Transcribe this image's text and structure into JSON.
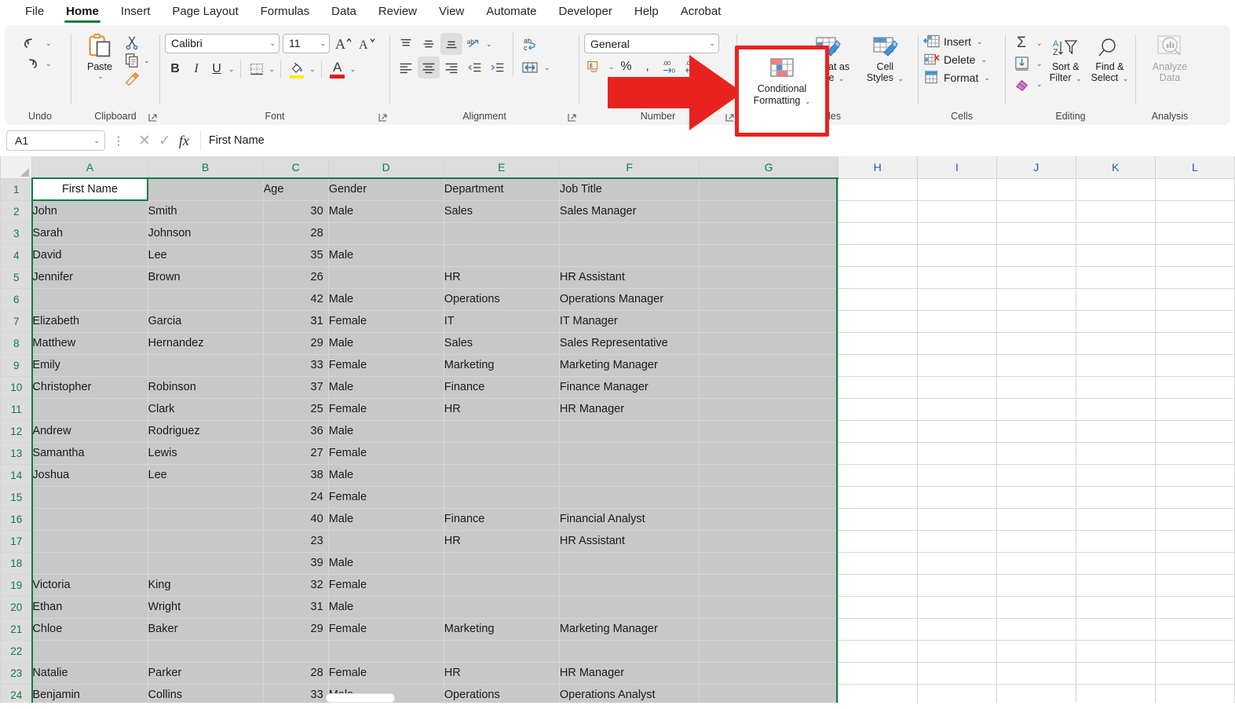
{
  "tabs": [
    {
      "label": "File",
      "active": false
    },
    {
      "label": "Home",
      "active": true
    },
    {
      "label": "Insert",
      "active": false
    },
    {
      "label": "Page Layout",
      "active": false
    },
    {
      "label": "Formulas",
      "active": false
    },
    {
      "label": "Data",
      "active": false
    },
    {
      "label": "Review",
      "active": false
    },
    {
      "label": "View",
      "active": false
    },
    {
      "label": "Automate",
      "active": false
    },
    {
      "label": "Developer",
      "active": false
    },
    {
      "label": "Help",
      "active": false
    },
    {
      "label": "Acrobat",
      "active": false
    }
  ],
  "ribbon": {
    "groups": {
      "undo": {
        "label": "Undo",
        "undo_icon": "undo-arrow-icon",
        "redo_icon": "redo-arrow-icon"
      },
      "clipboard": {
        "label": "Clipboard",
        "paste_label": "Paste",
        "cut_icon": "scissors-icon",
        "copy_icon": "copy-icon",
        "format_painter_icon": "format-painter-icon"
      },
      "font": {
        "label": "Font",
        "font_name": "Calibri",
        "font_size": "11",
        "grow_icon": "grow-font-icon",
        "shrink_icon": "shrink-font-icon",
        "bold": "B",
        "italic": "I",
        "underline": "U",
        "borders_icon": "borders-icon",
        "fill_color_icon": "fill-color-icon",
        "font_color_icon": "font-color-icon"
      },
      "alignment": {
        "label": "Alignment",
        "top_align_icon": "align-top-icon",
        "middle_align_icon": "align-middle-icon",
        "bottom_align_icon": "align-bottom-icon",
        "orientation_icon": "text-orientation-icon",
        "wrap_text_icon": "wrap-text-icon",
        "align_left_icon": "align-left-icon",
        "align_center_icon": "align-center-icon",
        "align_right_icon": "align-right-icon",
        "decrease_indent_icon": "decrease-indent-icon",
        "increase_indent_icon": "increase-indent-icon",
        "merge_center_icon": "merge-and-center-icon"
      },
      "number": {
        "label": "Number",
        "format": "General",
        "accounting_icon": "accounting-format-icon",
        "percent_icon": "percent-style-icon",
        "comma_icon": "comma-style-icon",
        "increase_decimal_icon": "increase-decimal-icon",
        "decrease_decimal_icon": "decrease-decimal-icon"
      },
      "styles": {
        "label": "Styles",
        "conditional_formatting": "Conditional\nFormatting",
        "conditional_formatting_line1": "Conditional",
        "conditional_formatting_line2": "Formatting",
        "format_as_table_line1": "Format as",
        "format_as_table_line2": "Table",
        "cell_styles_line1": "Cell",
        "cell_styles_line2": "Styles",
        "highlight_color": "#e8231f"
      },
      "cells": {
        "label": "Cells",
        "insert": "Insert",
        "delete": "Delete",
        "format": "Format"
      },
      "editing": {
        "label": "Editing",
        "autosum_icon": "autosum-sigma-icon",
        "fill_icon": "fill-down-icon",
        "clear_icon": "clear-eraser-icon",
        "sort_filter_line1": "Sort &",
        "sort_filter_line2": "Filter",
        "find_select_line1": "Find &",
        "find_select_line2": "Select"
      },
      "analysis": {
        "label": "Analysis",
        "analyze_line1": "Analyze",
        "analyze_line2": "Data"
      }
    }
  },
  "formula_bar": {
    "name_box": "A1",
    "cancel_icon": "cancel-x-icon",
    "enter_icon": "enter-check-icon",
    "function_icon": "insert-function-fx-icon",
    "formula_value": "First Name"
  },
  "grid": {
    "columns": [
      "A",
      "B",
      "C",
      "D",
      "E",
      "F",
      "G",
      "H",
      "I",
      "J",
      "K",
      "L"
    ],
    "selected_columns": [
      "A",
      "B",
      "C",
      "D",
      "E",
      "F",
      "G"
    ],
    "active_cell": "A1",
    "rows": [
      {
        "n": 1,
        "cells": [
          "First Name",
          "",
          "Age",
          "Gender",
          "Department",
          "Job Title",
          ""
        ]
      },
      {
        "n": 2,
        "cells": [
          "John",
          "Smith",
          "30",
          "Male",
          "Sales",
          "Sales Manager",
          ""
        ]
      },
      {
        "n": 3,
        "cells": [
          "Sarah",
          "Johnson",
          "28",
          "",
          "",
          "",
          ""
        ]
      },
      {
        "n": 4,
        "cells": [
          "David",
          "Lee",
          "35",
          "Male",
          "",
          "",
          ""
        ]
      },
      {
        "n": 5,
        "cells": [
          "Jennifer",
          "Brown",
          "26",
          "",
          "HR",
          "HR Assistant",
          ""
        ]
      },
      {
        "n": 6,
        "cells": [
          "",
          "",
          "42",
          "Male",
          "Operations",
          "Operations Manager",
          ""
        ]
      },
      {
        "n": 7,
        "cells": [
          "Elizabeth",
          "Garcia",
          "31",
          "Female",
          "IT",
          "IT Manager",
          ""
        ]
      },
      {
        "n": 8,
        "cells": [
          "Matthew",
          "Hernandez",
          "29",
          "Male",
          "Sales",
          "Sales Representative",
          ""
        ]
      },
      {
        "n": 9,
        "cells": [
          "Emily",
          "",
          "33",
          "Female",
          "Marketing",
          "Marketing Manager",
          ""
        ]
      },
      {
        "n": 10,
        "cells": [
          "Christopher",
          "Robinson",
          "37",
          "Male",
          "Finance",
          "Finance Manager",
          ""
        ]
      },
      {
        "n": 11,
        "cells": [
          "",
          "Clark",
          "25",
          "Female",
          "HR",
          "HR Manager",
          ""
        ]
      },
      {
        "n": 12,
        "cells": [
          "Andrew",
          "Rodriguez",
          "36",
          "Male",
          "",
          "",
          ""
        ]
      },
      {
        "n": 13,
        "cells": [
          "Samantha",
          "Lewis",
          "27",
          "Female",
          "",
          "",
          ""
        ]
      },
      {
        "n": 14,
        "cells": [
          "Joshua",
          "Lee",
          "38",
          "Male",
          "",
          "",
          ""
        ]
      },
      {
        "n": 15,
        "cells": [
          "",
          "",
          "24",
          "Female",
          "",
          "",
          ""
        ]
      },
      {
        "n": 16,
        "cells": [
          "",
          "",
          "40",
          "Male",
          "Finance",
          "Financial Analyst",
          ""
        ]
      },
      {
        "n": 17,
        "cells": [
          "",
          "",
          "23",
          "",
          "HR",
          "HR Assistant",
          ""
        ]
      },
      {
        "n": 18,
        "cells": [
          "",
          "",
          "39",
          "Male",
          "",
          "",
          ""
        ]
      },
      {
        "n": 19,
        "cells": [
          "Victoria",
          "King",
          "32",
          "Female",
          "",
          "",
          ""
        ]
      },
      {
        "n": 20,
        "cells": [
          "Ethan",
          "Wright",
          "31",
          "Male",
          "",
          "",
          ""
        ]
      },
      {
        "n": 21,
        "cells": [
          "Chloe",
          "Baker",
          "29",
          "Female",
          "Marketing",
          "Marketing Manager",
          ""
        ]
      },
      {
        "n": 22,
        "cells": [
          "",
          "",
          "",
          "",
          "",
          "",
          ""
        ]
      },
      {
        "n": 23,
        "cells": [
          "Natalie",
          "Parker",
          "28",
          "Female",
          "HR",
          "HR Manager",
          ""
        ]
      },
      {
        "n": 24,
        "cells": [
          "Benjamin",
          "Collins",
          "33",
          "Male",
          "Operations",
          "Operations Analyst",
          ""
        ]
      }
    ]
  },
  "annotation": {
    "arrow_color": "#e8231f",
    "arrow_icon": "red-right-arrow-pointer",
    "highlight_target": "Conditional Formatting"
  }
}
